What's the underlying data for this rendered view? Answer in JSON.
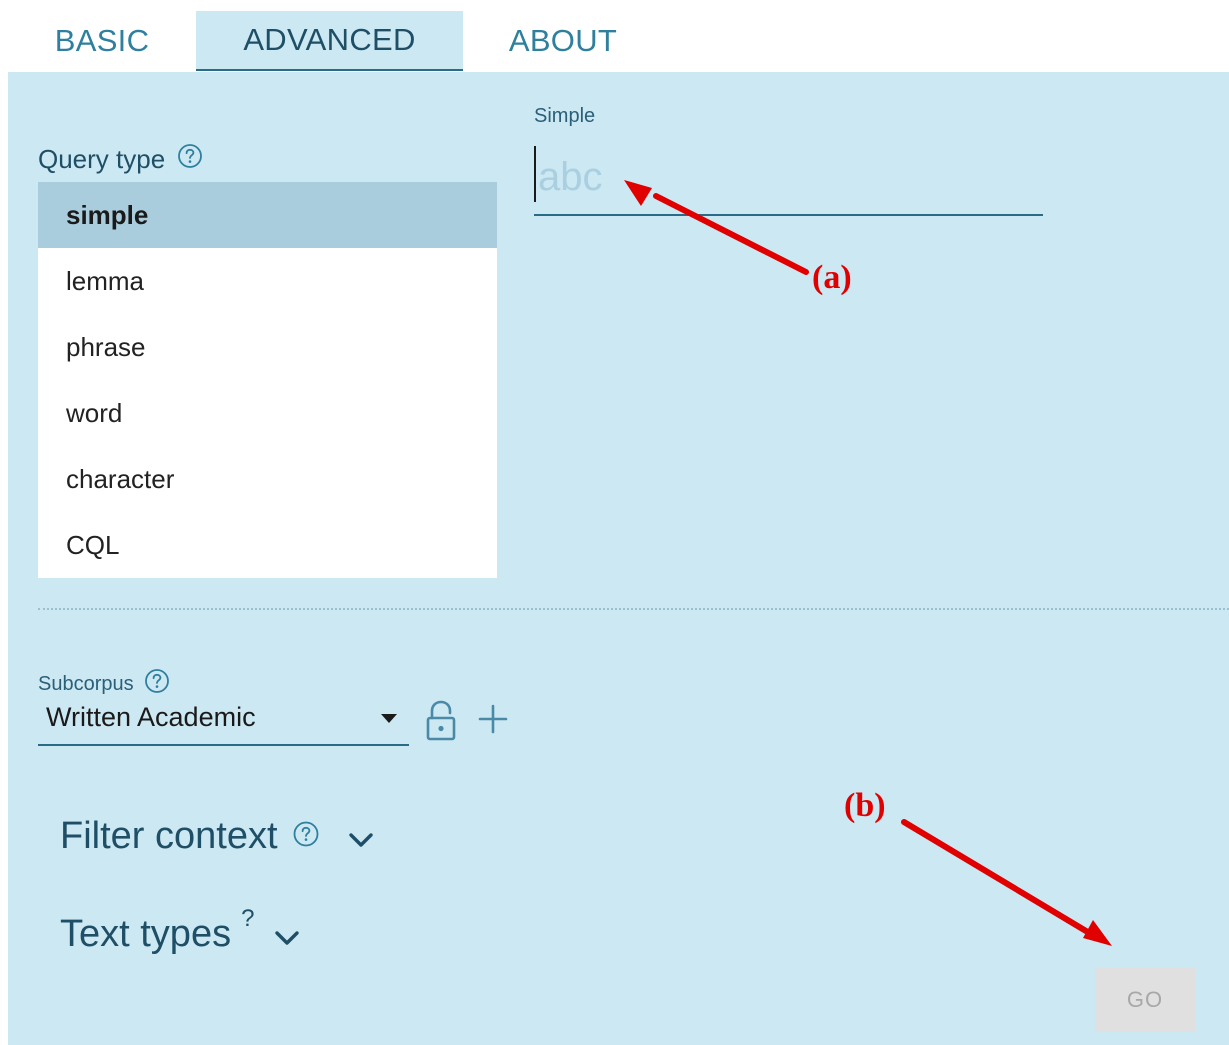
{
  "tabs": [
    {
      "label": "BASIC",
      "active": false
    },
    {
      "label": "ADVANCED",
      "active": true
    },
    {
      "label": "ABOUT",
      "active": false
    }
  ],
  "query_type": {
    "label": "Query type",
    "help_icon": "help-circle-icon",
    "options": [
      "simple",
      "lemma",
      "phrase",
      "word",
      "character",
      "CQL"
    ],
    "selected": "simple"
  },
  "simple": {
    "label": "Simple",
    "value": "",
    "placeholder": "abc"
  },
  "subcorpus": {
    "label": "Subcorpus",
    "help_icon": "help-circle-icon",
    "value": "Written Academic",
    "icons": [
      "caret-down-icon",
      "lock-icon",
      "plus-icon"
    ]
  },
  "filter_context": {
    "label": "Filter context",
    "help_icon": "help-circle-icon",
    "expand_icon": "chevron-down-icon"
  },
  "text_types": {
    "label": "Text types",
    "help_mark": "?",
    "expand_icon": "chevron-down-icon"
  },
  "go_button": {
    "label": "GO",
    "enabled": false
  },
  "annotations": {
    "a": "(a)",
    "b": "(b)"
  },
  "colors": {
    "panel_bg": "#cce8f2",
    "accent": "#2a6b86",
    "selected_bg": "#a9cddd",
    "annotation": "#e00000",
    "button_disabled": "#e0e0e0"
  }
}
